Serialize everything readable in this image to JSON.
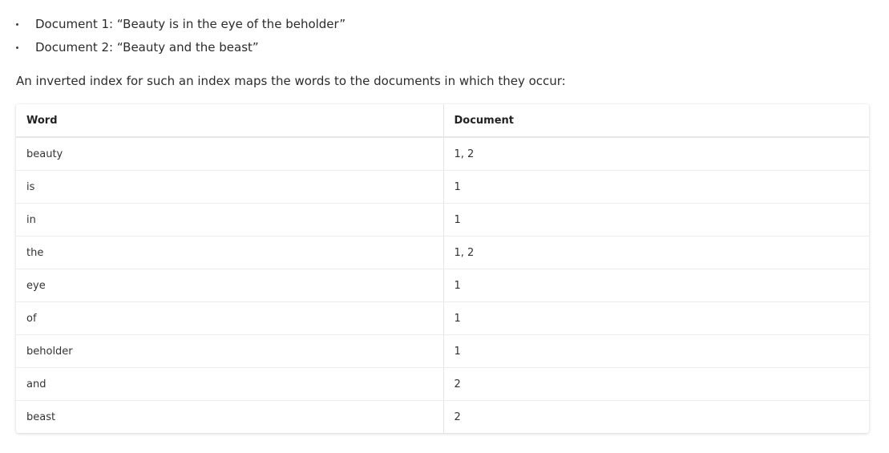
{
  "bullets": [
    "Document 1: “Beauty is in the eye of the beholder”",
    "Document 2: “Beauty and the beast”"
  ],
  "intro": "An inverted index for such an index maps the words to the documents in which they occur:",
  "table": {
    "headers": [
      "Word",
      "Document"
    ],
    "rows": [
      [
        "beauty",
        "1, 2"
      ],
      [
        "is",
        "1"
      ],
      [
        "in",
        "1"
      ],
      [
        "the",
        "1, 2"
      ],
      [
        "eye",
        "1"
      ],
      [
        "of",
        "1"
      ],
      [
        "beholder",
        "1"
      ],
      [
        "and",
        "2"
      ],
      [
        "beast",
        "2"
      ]
    ]
  }
}
